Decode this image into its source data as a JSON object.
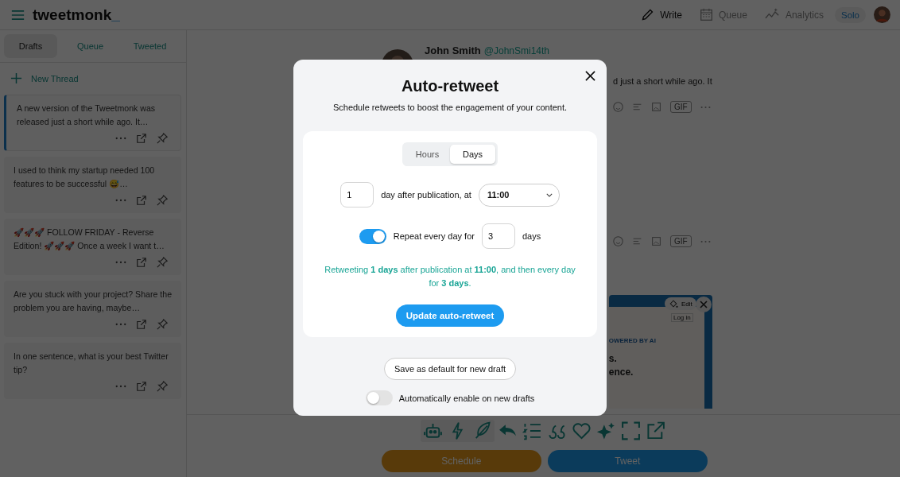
{
  "header": {
    "logo": "tweetmonk",
    "logo_cursor": "_",
    "nav": [
      {
        "label": "Write",
        "kind": "write",
        "selected": true
      },
      {
        "label": "Queue",
        "kind": "queue",
        "selected": false
      },
      {
        "label": "Analytics",
        "kind": "analytics",
        "selected": false
      }
    ],
    "plan_badge": "Solo"
  },
  "sidebar": {
    "tabs": [
      {
        "label": "Drafts",
        "selected": true
      },
      {
        "label": "Queue",
        "selected": false
      },
      {
        "label": "Tweeted",
        "selected": false
      }
    ],
    "new_thread": "New Thread",
    "drafts": [
      {
        "text": "A new version of the Tweetmonk was released just a short while ago. It…",
        "selected": true
      },
      {
        "text": "I used to think my startup needed 100 features to be successful 😅…",
        "selected": false
      },
      {
        "text": "🚀🚀🚀 FOLLOW FRIDAY - Reverse Edition! 🚀🚀🚀 Once a week I want t…",
        "selected": false
      },
      {
        "text": "Are you stuck with your project? Share the problem you are having, maybe…",
        "selected": false
      },
      {
        "text": "In one sentence, what is your best Twitter tip?",
        "selected": false
      }
    ]
  },
  "editor": {
    "author_name": "John Smith",
    "author_handle": "@JohnSmi14th",
    "text_fragment": "d just a short while ago. It",
    "post_toolbars": [
      {
        "gif": "GIF"
      },
      {
        "gif": "GIF"
      }
    ],
    "image_preview": {
      "edit": "Edit",
      "login": "Log in",
      "tagline": "OWERED BY AI",
      "line_1": "s.",
      "line_2": "ence."
    }
  },
  "bottom_bar": {
    "ai_tools": [
      {
        "kind": "robot"
      },
      {
        "kind": "bolt"
      },
      {
        "kind": "feather"
      }
    ],
    "tools": [
      {
        "kind": "reply"
      },
      {
        "kind": "list"
      },
      {
        "kind": "quote"
      },
      {
        "kind": "heart"
      },
      {
        "kind": "sparkles"
      },
      {
        "kind": "expand"
      },
      {
        "kind": "external"
      }
    ],
    "schedule": "Schedule",
    "tweet": "Tweet"
  },
  "modal": {
    "title": "Auto-retweet",
    "subtitle": "Schedule retweets to boost the engagement of your content.",
    "unit_tabs": [
      {
        "label": "Hours",
        "selected": false
      },
      {
        "label": "Days",
        "selected": true
      }
    ],
    "offset_value": "1",
    "offset_label": "day after publication, at",
    "time": "11:00",
    "repeat": {
      "on": true,
      "label": "Repeat every day for",
      "value": "3",
      "unit": "days"
    },
    "summary": "Retweeting **1 days** after publication at **11:00**, and then every day for **3 days**.",
    "update_button": "Update auto-retweet",
    "save_default_button": "Save as default for new draft",
    "auto_enable": {
      "on": false,
      "label": "Automatically enable on new drafts"
    }
  }
}
